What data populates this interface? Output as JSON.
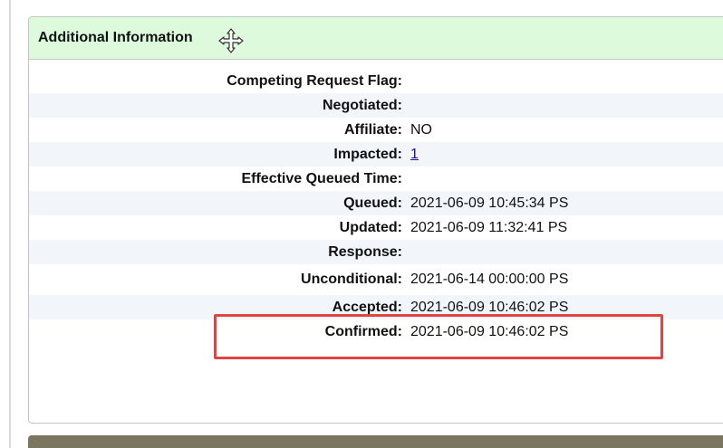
{
  "panel": {
    "title": "Additional Information"
  },
  "rows": [
    {
      "label": "Competing Request Flag:",
      "value": ""
    },
    {
      "label": "Negotiated:",
      "value": ""
    },
    {
      "label": "Affiliate:",
      "value": "NO"
    },
    {
      "label": "Impacted:",
      "value": "1"
    },
    {
      "label": "Effective Queued Time:",
      "value": ""
    },
    {
      "label": "Queued:",
      "value": "2021-06-09 10:45:34 PS"
    },
    {
      "label": "Updated:",
      "value": "2021-06-09 11:32:41 PS"
    },
    {
      "label": "Response:",
      "value": ""
    },
    {
      "label": "Unconditional:",
      "value": "2021-06-14 00:00:00 PS"
    },
    {
      "label": "Accepted:",
      "value": "2021-06-09 10:46:02 PS"
    },
    {
      "label": "Confirmed:",
      "value": "2021-06-09 10:46:02 PS"
    }
  ],
  "colors": {
    "header_bg": "#ddfadd",
    "stripe_bg": "#f2f6fa",
    "highlight": "#e0453f",
    "link": "#1a0dab"
  },
  "icons": {
    "move": "move-cursor-icon"
  }
}
